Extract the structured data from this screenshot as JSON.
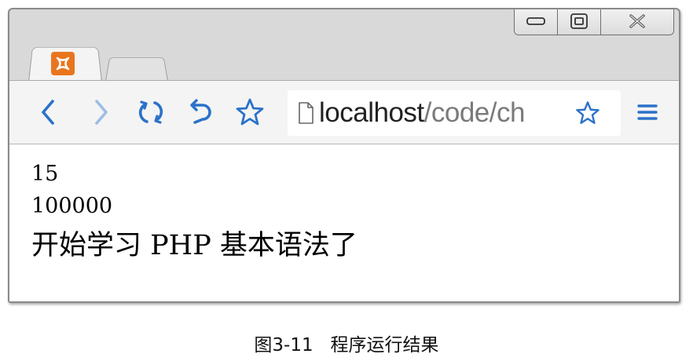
{
  "browser": {
    "active_tab": {
      "favicon": "xampp-icon"
    },
    "new_tab": {
      "icon": "new-tab"
    },
    "window_controls": [
      "minimize-icon",
      "maximize-icon",
      "close-icon"
    ],
    "toolbar": {
      "back_icon": "chevron-left-icon",
      "forward_icon": "chevron-right-icon",
      "reload_icon": "reload-icon",
      "undo_icon": "undo-icon",
      "bookmark_icon": "star-icon",
      "menu_icon": "hamburger-icon"
    },
    "address_bar": {
      "host": "localhost",
      "path": "/code/ch",
      "page_icon": "page-icon",
      "star_icon": "star-icon"
    }
  },
  "page": {
    "lines": [
      "15",
      "100000",
      "开始学习 PHP 基本语法了"
    ]
  },
  "caption": "图3-11   程序运行结果",
  "colors": {
    "accent": "#2a72c9",
    "favicon": "#e9761f"
  }
}
